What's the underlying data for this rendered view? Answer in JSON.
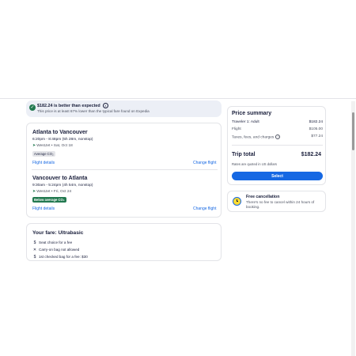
{
  "deal": {
    "title": "$182.24 is better than expected",
    "subtitle": "This price is at least 67% lower than the typical fare found on Expedia"
  },
  "flights": [
    {
      "title": "Atlanta to Vancouver",
      "time": "6:20pm - 8:48pm (5h 28m, nonstop)",
      "airline": "WestJet • Sat, Oct 18",
      "emissions": "Average CO₂",
      "details_link": "Flight details",
      "change_link": "Change flight"
    },
    {
      "title": "Vancouver to Atlanta",
      "time": "9:30am - 5:24pm (4h 54m, nonstop)",
      "airline": "WestJet • Fri, Oct 24",
      "emissions": "Below average CO₂",
      "details_link": "Flight details",
      "change_link": "Change flight"
    }
  ],
  "fare": {
    "title": "Your fare: Ultrabasic",
    "items": [
      {
        "icon": "dollar-icon",
        "glyph": "$",
        "text": "Seat choice for a fee"
      },
      {
        "icon": "x-icon",
        "glyph": "✕",
        "text": "Carry-on bag not allowed"
      },
      {
        "icon": "dollar-icon",
        "glyph": "$",
        "text": "1st checked bag for a fee: $30"
      }
    ]
  },
  "price_summary": {
    "title": "Price summary",
    "traveler_label": "Traveler 1: Adult",
    "traveler_value": "$182.24",
    "flight_label": "Flight",
    "flight_value": "$105.00",
    "taxes_label": "Taxes, fees, and charges",
    "taxes_value": "$77.24",
    "total_label": "Trip total",
    "total_value": "$182.24",
    "currency_note": "Rates are quoted in US dollars",
    "select_button": "Select"
  },
  "cancellation": {
    "title": "Free cancellation",
    "text": "There's no fee to cancel within 24 hours of booking."
  },
  "colors": {
    "brand_blue": "#1668e3",
    "deal_green": "#227950",
    "text_dark": "#191e3b"
  }
}
